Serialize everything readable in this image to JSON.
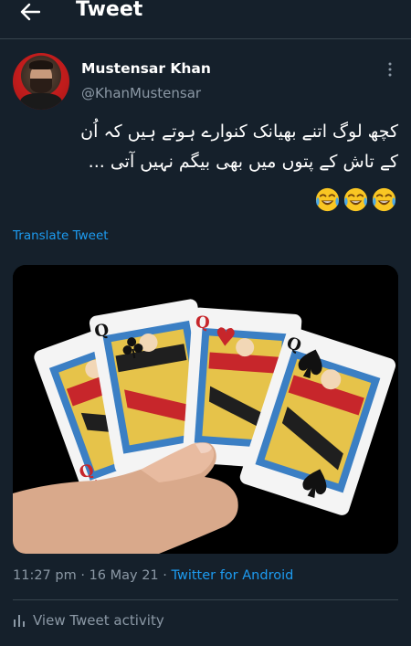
{
  "header": {
    "title": "Tweet",
    "back_icon": "arrow-left-icon"
  },
  "author": {
    "name": "Mustensar Khan",
    "handle": "@KhanMustensar",
    "more_icon": "more-vertical-icon"
  },
  "tweet": {
    "lines": [
      "کچھ لوگ اتنے بھیانک کنوارے ہوتے ہیں کہ اُن",
      "کے تاش کے پتوں میں بھی بیگم نہیں آتی ..."
    ],
    "emoji": [
      "face-with-tears-of-joy",
      "face-with-tears-of-joy",
      "face-with-tears-of-joy"
    ],
    "translate_label": "Translate Tweet",
    "media_icon": "playing-cards-image"
  },
  "meta": {
    "time": "11:27 pm",
    "separator": " · ",
    "date": "16 May 21",
    "source": "Twitter for Android"
  },
  "activity": {
    "label": "View Tweet activity",
    "icon": "bar-chart-icon"
  },
  "colors": {
    "background": "#15202b",
    "accent": "#1d9bf0",
    "secondary_text": "#8b98a5",
    "divider": "#38444d"
  }
}
